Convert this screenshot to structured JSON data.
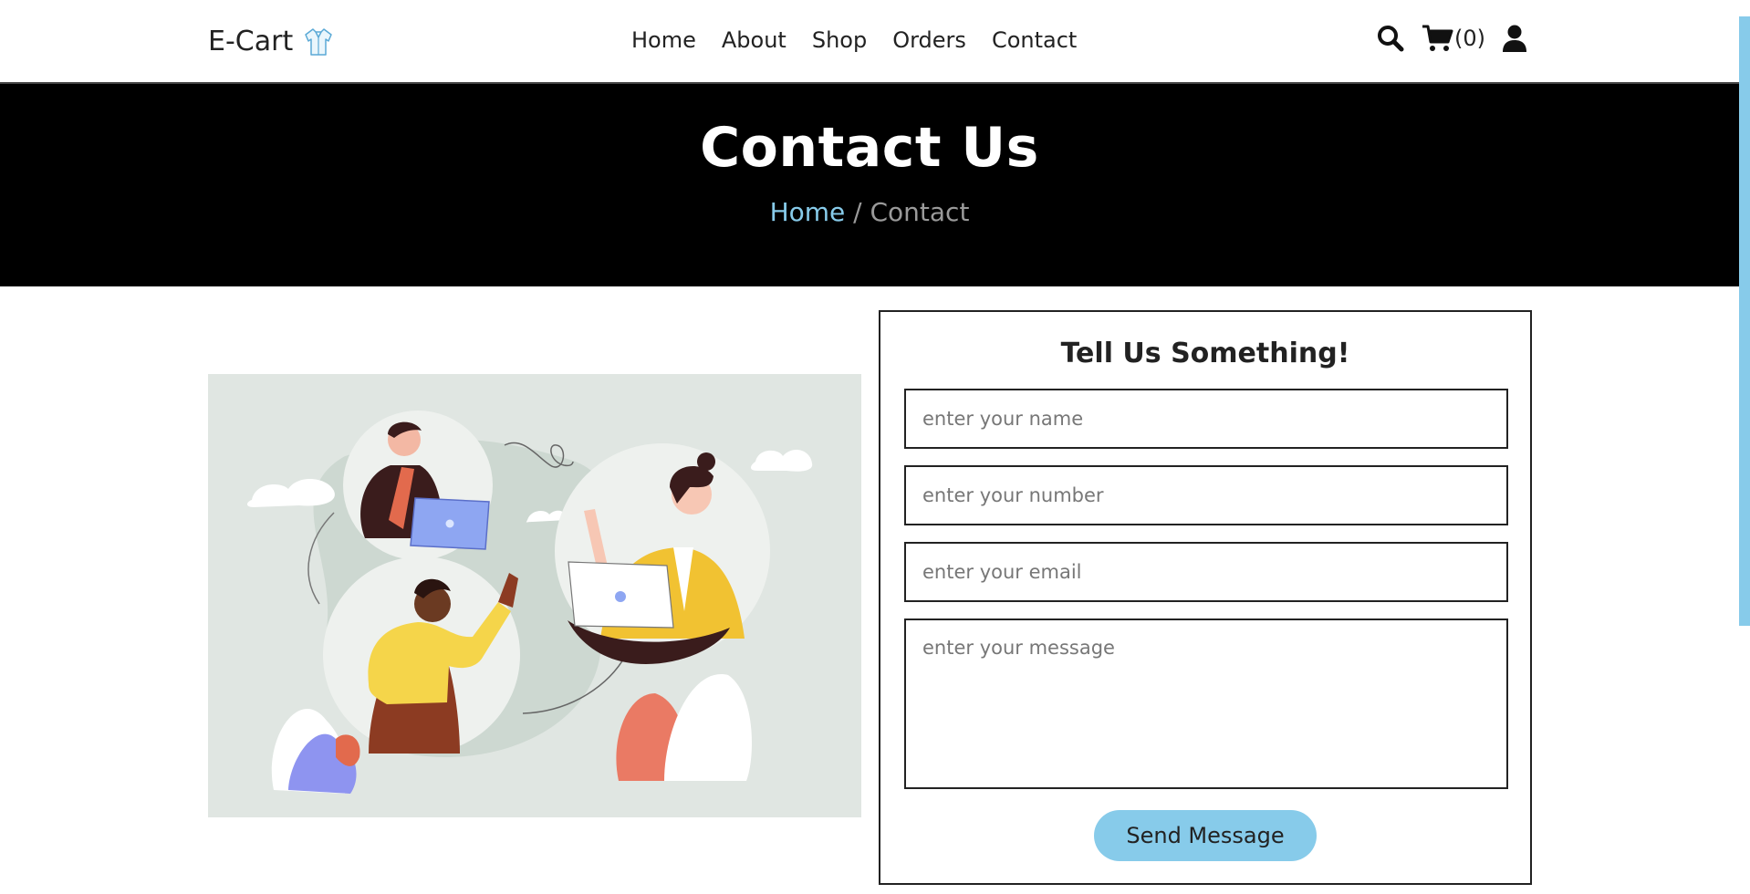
{
  "header": {
    "brand": "E-Cart",
    "nav": [
      "Home",
      "About",
      "Shop",
      "Orders",
      "Contact"
    ],
    "cart_count": "(0)",
    "icons": [
      "search-icon",
      "cart-icon",
      "user-icon",
      "shirt-logo-icon"
    ]
  },
  "hero": {
    "title": "Contact Us",
    "breadcrumb_home": "Home",
    "breadcrumb_sep": " / ",
    "breadcrumb_current": "Contact"
  },
  "form": {
    "title": "Tell Us Something!",
    "name_placeholder": "enter your name",
    "number_placeholder": "enter your number",
    "email_placeholder": "enter your email",
    "message_placeholder": "enter your message",
    "submit_label": "Send Message"
  },
  "colors": {
    "accent": "#87cbea",
    "hero_bg": "#000000",
    "illustration_bg": "#e0e6e2"
  }
}
